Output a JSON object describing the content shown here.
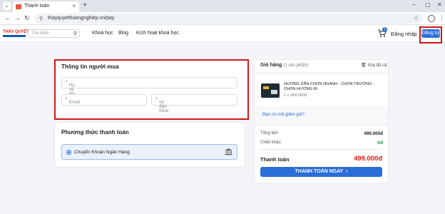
{
  "browser": {
    "tab_title": "Thanh toán",
    "url": "thayquyethuongnghiep.vn/pay"
  },
  "header": {
    "logo_text": "THẦY QUYẾT",
    "search_placeholder": "Tìm kiếm",
    "nav": [
      "Khoá học",
      "Blog",
      "Kích hoạt khoá học"
    ],
    "cart_count": "1",
    "login": "Đăng nhập",
    "register": "Đăng ký"
  },
  "buyer": {
    "title": "Thông tin người mua",
    "name_ph": "Họ và tên",
    "email_ph": "Email",
    "phone_ph": "Số điện thoại"
  },
  "payment": {
    "title": "Phương thức thanh toán",
    "option": "Chuyển Khoản Ngân Hàng"
  },
  "cart": {
    "title": "Giỏ hàng",
    "count": "(1 sản phẩm)",
    "clear_all": "Xóa tất cả",
    "item_name": "HƯỚNG DẪN CHỌN NGÀNH - CHỌN TRƯỜNG - CHỌN HƯỚNG ĐI",
    "item_price": "1 x 499.000đ",
    "coupon": "Bạn có mã giảm giá?",
    "subtotal_label": "Tổng tiền",
    "subtotal_value": "499.000đ",
    "discount_label": "Chiết khấu",
    "discount_value": "-0đ",
    "total_label": "Thanh toán",
    "total_value": "499.000đ",
    "pay_button": "THANH TOÁN NGAY"
  },
  "colors": {
    "primary": "#2b6ed8",
    "highlight": "#d01919",
    "price_red": "#e01818",
    "discount_green": "#1e9e4a"
  }
}
